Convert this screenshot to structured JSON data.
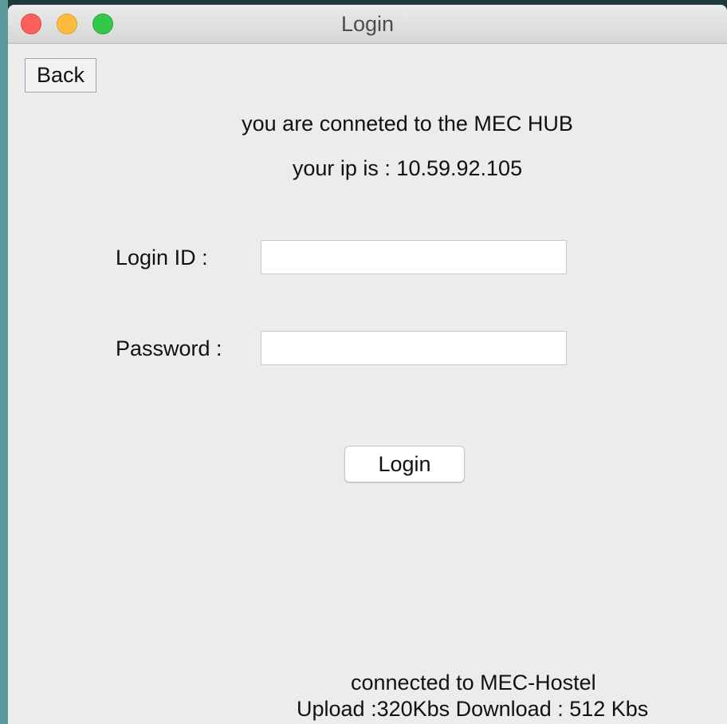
{
  "window": {
    "title": "Login"
  },
  "toolbar": {
    "back_label": "Back"
  },
  "info": {
    "connected_message": "you are conneted to the MEC HUB",
    "ip_message": "your ip is : 10.59.92.105"
  },
  "form": {
    "login_id_label": "Login ID :",
    "login_id_value": "",
    "password_label": "Password :",
    "password_value": "",
    "login_button_label": "Login"
  },
  "status": {
    "network": "connected to MEC-Hostel",
    "speed": "Upload :320Kbs Download : 512 Kbs"
  },
  "colors": {
    "close": "#fc605c",
    "minimize": "#fdbc40",
    "maximize": "#34c84a",
    "window_bg": "#ececec",
    "desktop_edge": "#5a9a9a"
  }
}
